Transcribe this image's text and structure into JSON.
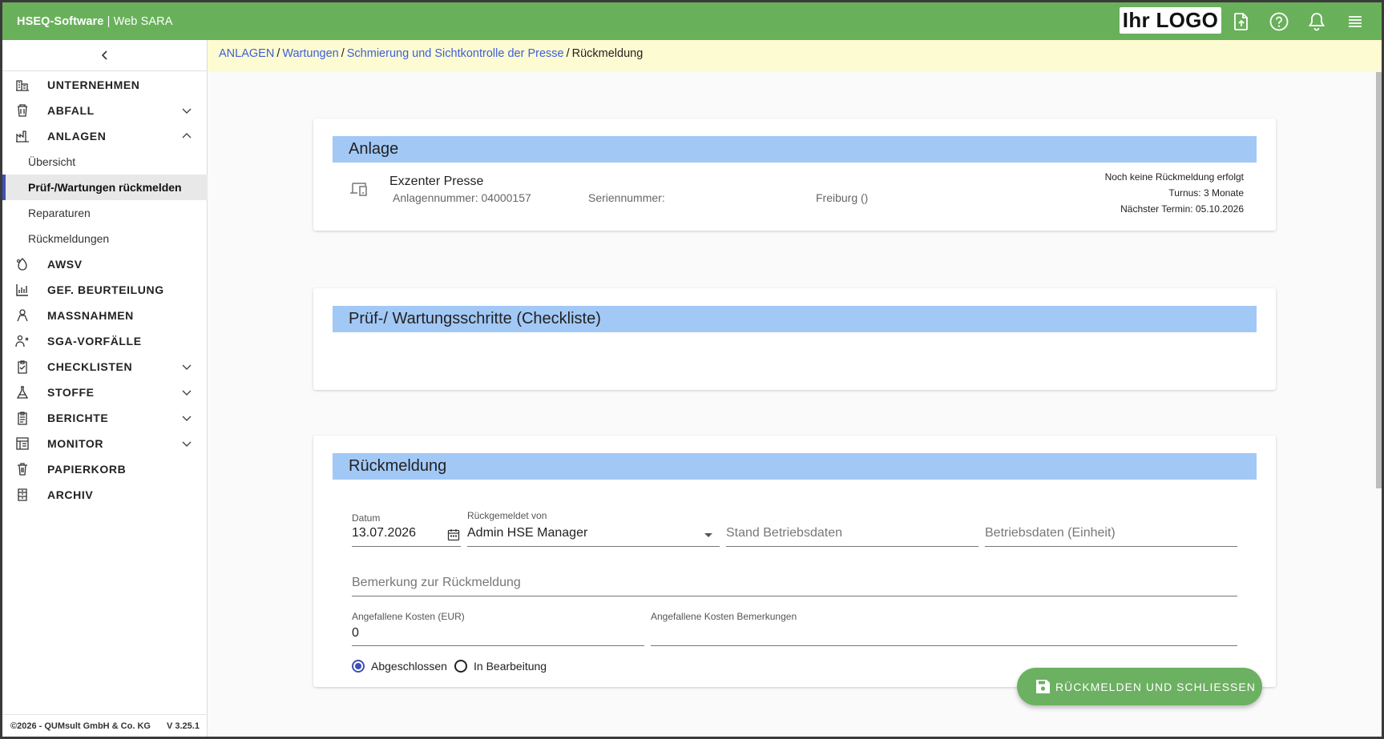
{
  "app": {
    "brand_strong": "HSEQ-Software",
    "brand_sep": " | ",
    "brand_rest": "Web SARA",
    "logo_text": "Ihr LOGO",
    "accent": "#69b05b"
  },
  "topbar_icons": [
    "file-upload-icon",
    "help-icon",
    "bell-icon",
    "menu-icon"
  ],
  "sidebar": {
    "items": [
      {
        "label": "UNTERNEHMEN",
        "icon": "company-icon"
      },
      {
        "label": "ABFALL",
        "icon": "waste-icon"
      },
      {
        "label": "ANLAGEN",
        "icon": "plant-icon"
      },
      {
        "label": "Übersicht"
      },
      {
        "label": "Prüf-/Wartungen rückmelden"
      },
      {
        "label": "Reparaturen"
      },
      {
        "label": "Rückmeldungen"
      },
      {
        "label": "AWSV",
        "icon": "awsv-icon"
      },
      {
        "label": "GEF. BEURTEILUNG",
        "icon": "risk-icon"
      },
      {
        "label": "MASSNAHMEN",
        "icon": "measures-icon"
      },
      {
        "label": "SGA-VORFÄLLE",
        "icon": "incident-icon"
      },
      {
        "label": "CHECKLISTEN",
        "icon": "checklist-icon"
      },
      {
        "label": "STOFFE",
        "icon": "flask-icon"
      },
      {
        "label": "BERICHTE",
        "icon": "report-icon"
      },
      {
        "label": "MONITOR",
        "icon": "monitor-icon"
      },
      {
        "label": "PAPIERKORB",
        "icon": "trash-icon"
      },
      {
        "label": "ARCHIV",
        "icon": "archive-icon"
      }
    ],
    "footer_copyright": "©2026 - QUMsult GmbH & Co. KG",
    "footer_version": "V 3.25.1"
  },
  "breadcrumb": {
    "items": [
      "ANLAGEN",
      "Wartungen",
      "Schmierung und Sichtkontrolle der Presse"
    ],
    "current": "Rückmeldung"
  },
  "anlage": {
    "heading": "Anlage",
    "name": "Exzenter Presse",
    "number": "Anlagennummer: 04000157",
    "serial": "Seriennummer:",
    "location": "Freiburg ()",
    "status": "Noch keine Rückmeldung erfolgt",
    "turnus": "Turnus: 3 Monate",
    "next_date": "Nächster Termin: 05.10.2026"
  },
  "checklist": {
    "heading": "Prüf-/ Wartungsschritte (Checkliste)"
  },
  "feedback": {
    "heading": "Rückmeldung",
    "date_label": "Datum",
    "date_value": "13.07.2026",
    "by_label": "Rückgemeldet von",
    "by_value": "Admin HSE Manager",
    "stand_placeholder": "Stand Betriebsdaten",
    "unit_placeholder": "Betriebsdaten (Einheit)",
    "remark_placeholder": "Bemerkung zur Rückmeldung",
    "cost_label": "Angefallene Kosten (EUR)",
    "cost_value": "0",
    "cost_remark_label": "Angefallene Kosten Bemerkungen",
    "cost_remark_value": "",
    "radio_done": "Abgeschlossen",
    "radio_progress": "In Bearbeitung",
    "selected_status": "Abgeschlossen"
  },
  "submit_button": "RÜCKMELDEN UND SCHLIESSEN"
}
